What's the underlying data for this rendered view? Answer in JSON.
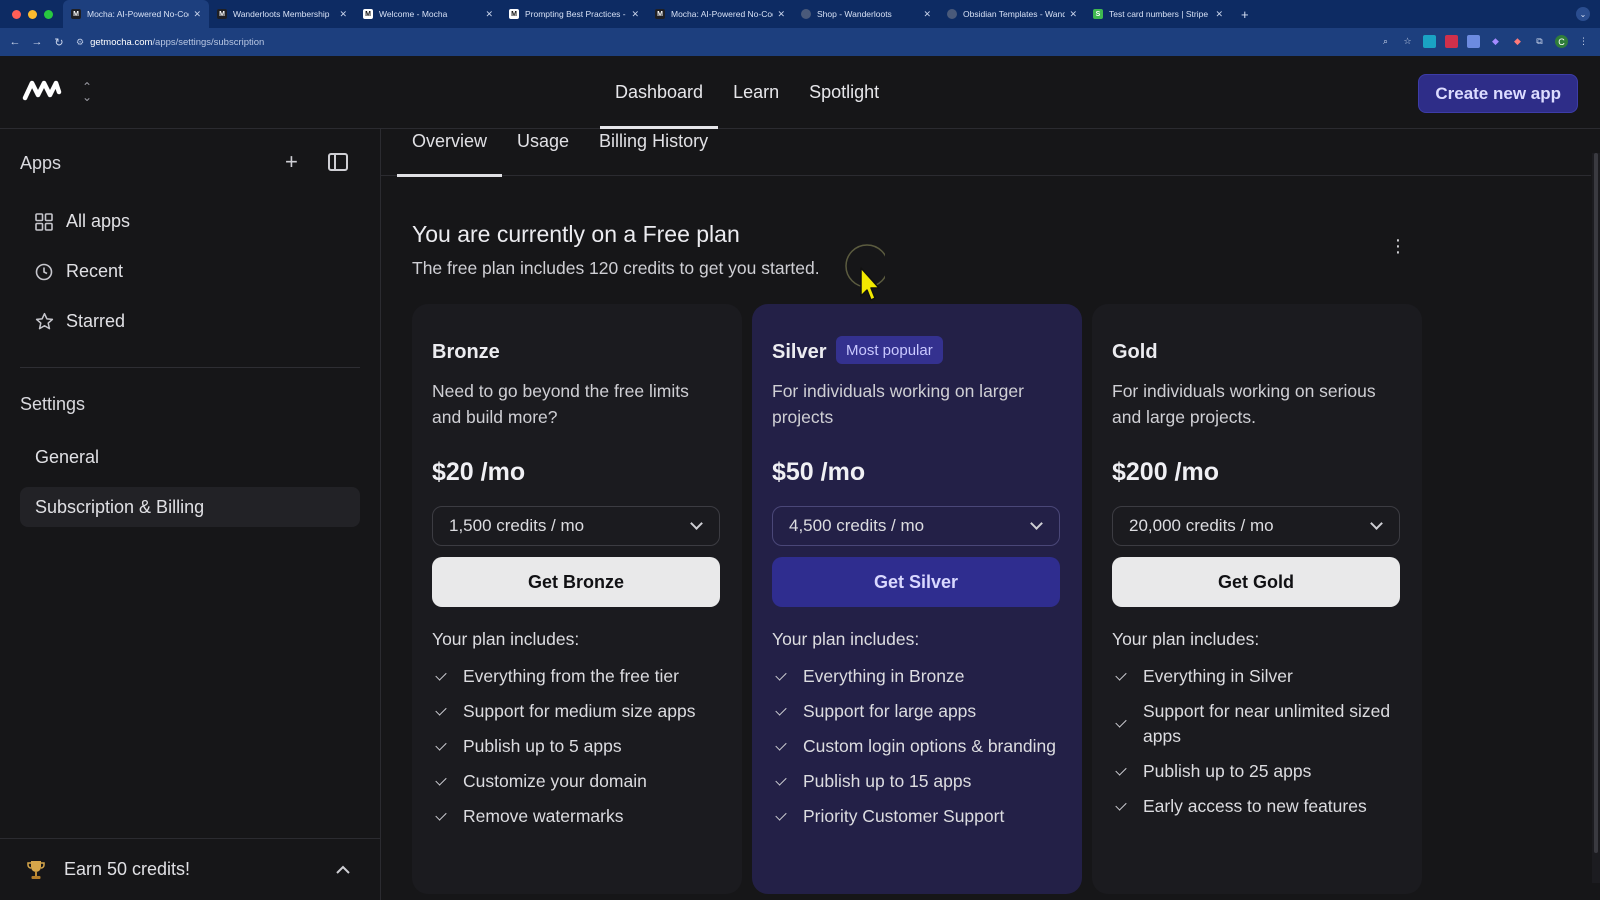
{
  "browser": {
    "tabs": [
      {
        "title": "Mocha: AI-Powered No-Code",
        "favicon": "mocha-icon",
        "active": true
      },
      {
        "title": "Wanderloots Membership",
        "favicon": "mocha-icon",
        "active": false
      },
      {
        "title": "Welcome - Mocha",
        "favicon": "m-icon",
        "active": false
      },
      {
        "title": "Prompting Best Practices - M",
        "favicon": "m-icon",
        "active": false
      },
      {
        "title": "Mocha: AI-Powered No-Code",
        "favicon": "mocha-icon",
        "active": false
      },
      {
        "title": "Shop - Wanderloots",
        "favicon": "globe-icon",
        "active": false
      },
      {
        "title": "Obsidian Templates - Wander",
        "favicon": "globe-icon",
        "active": false
      },
      {
        "title": "Test card numbers | Stripe Do",
        "favicon": "stripe-icon",
        "active": false
      }
    ],
    "url_host": "getmocha.com",
    "url_path": "/apps/settings/subscription"
  },
  "header": {
    "nav": [
      "Dashboard",
      "Learn",
      "Spotlight"
    ],
    "active_nav": "Dashboard",
    "create_label": "Create new app"
  },
  "sidebar": {
    "title": "Apps",
    "items": [
      {
        "label": "All apps",
        "icon": "grid-icon"
      },
      {
        "label": "Recent",
        "icon": "clock-icon"
      },
      {
        "label": "Starred",
        "icon": "star-icon"
      }
    ],
    "settings_title": "Settings",
    "settings_items": [
      {
        "label": "General",
        "active": false
      },
      {
        "label": "Subscription & Billing",
        "active": true
      }
    ],
    "footer_label": "Earn 50 credits!"
  },
  "main": {
    "tabs": [
      "Overview",
      "Usage",
      "Billing History"
    ],
    "active_tab": "Overview",
    "plan_title": "You are currently on a Free plan",
    "plan_subtitle": "The free plan includes 120 credits to get you started.",
    "includes_label": "Your plan includes:",
    "plans": [
      {
        "name": "Bronze",
        "badge": "",
        "description": "Need to go beyond the free limits and build more?",
        "price": "$20 /mo",
        "credits": "1,500 credits / mo",
        "button": "Get Bronze",
        "features": [
          "Everything from the free tier",
          "Support for medium size apps",
          "Publish up to 5 apps",
          "Customize your domain",
          "Remove watermarks"
        ]
      },
      {
        "name": "Silver",
        "badge": "Most popular",
        "description": "For individuals working on larger projects",
        "price": "$50 /mo",
        "credits": "4,500 credits / mo",
        "button": "Get Silver",
        "features": [
          "Everything in Bronze",
          "Support for large apps",
          "Custom login options & branding",
          "Publish up to 15 apps",
          "Priority Customer Support"
        ]
      },
      {
        "name": "Gold",
        "badge": "",
        "description": "For individuals working on serious and large projects.",
        "price": "$200 /mo",
        "credits": "20,000 credits / mo",
        "button": "Get Gold",
        "features": [
          "Everything in Silver",
          "Support for near unlimited sized apps",
          "Publish up to 25 apps",
          "Early access to new features"
        ]
      }
    ]
  },
  "colors": {
    "accent": "#2e2d88",
    "badge_bg": "#34318f",
    "background": "#161618",
    "browser_chrome": "#0d2b63"
  }
}
